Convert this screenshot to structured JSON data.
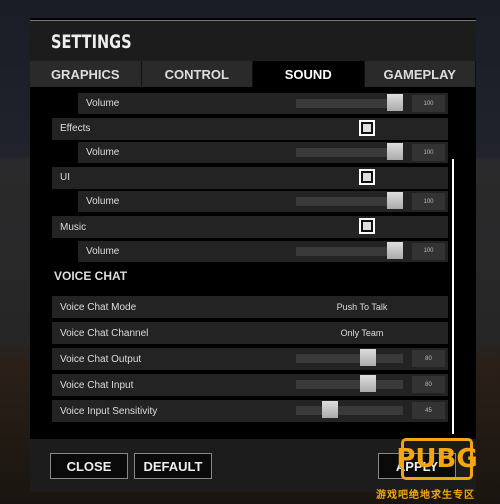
{
  "title": "SETTINGS",
  "tabs": [
    {
      "label": "GRAPHICS"
    },
    {
      "label": "CONTROL"
    },
    {
      "label": "SOUND",
      "active": true
    },
    {
      "label": "GAMEPLAY"
    }
  ],
  "sound": [
    {
      "type": "slider",
      "label": "Volume",
      "value": 100
    },
    {
      "type": "check",
      "label": "Effects",
      "checked": true
    },
    {
      "type": "slider",
      "label": "Volume",
      "value": 100
    },
    {
      "type": "check",
      "label": "UI",
      "checked": true
    },
    {
      "type": "slider",
      "label": "Volume",
      "value": 100
    },
    {
      "type": "check",
      "label": "Music",
      "checked": true
    },
    {
      "type": "slider",
      "label": "Volume",
      "value": 100
    }
  ],
  "voice_chat": {
    "heading": "VOICE CHAT",
    "rows": [
      {
        "type": "select",
        "label": "Voice Chat Mode",
        "value": "Push To Talk"
      },
      {
        "type": "select",
        "label": "Voice Chat Channel",
        "value": "Only Team"
      },
      {
        "type": "slider",
        "label": "Voice Chat Output",
        "value": 80
      },
      {
        "type": "slider",
        "label": "Voice Chat Input",
        "value": 80
      },
      {
        "type": "slider",
        "label": "Voice Input Sensitivity",
        "value": 45
      }
    ]
  },
  "footer": {
    "close": "CLOSE",
    "default": "DEFAULT",
    "apply": "APPLY"
  },
  "watermark": {
    "logo": "PUBG",
    "text": "游戏吧绝地求生专区"
  },
  "colors": {
    "accent": "#f3a60f"
  }
}
